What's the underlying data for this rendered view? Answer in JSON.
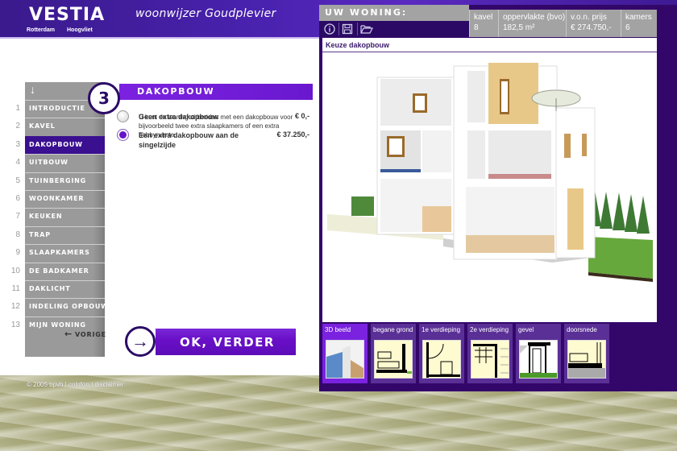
{
  "header": {
    "logo_word": "VESTIA",
    "logo_sub_left": "Rotterdam",
    "logo_sub_right": "Hoogvliet",
    "app_title": "woonwijzer Goudplevier"
  },
  "steps": {
    "head_icon": "down-arrow-icon",
    "head_glyph": "↓",
    "items": [
      {
        "num": "1",
        "label": "INTRODUCTIE",
        "active": false
      },
      {
        "num": "2",
        "label": "KAVEL",
        "active": false
      },
      {
        "num": "3",
        "label": "DAKOPBOUW",
        "active": true
      },
      {
        "num": "4",
        "label": "UITBOUW",
        "active": false
      },
      {
        "num": "5",
        "label": "TUINBERGING",
        "active": false
      },
      {
        "num": "6",
        "label": "WOONKAMER",
        "active": false
      },
      {
        "num": "7",
        "label": "KEUKEN",
        "active": false
      },
      {
        "num": "8",
        "label": "TRAP",
        "active": false
      },
      {
        "num": "9",
        "label": "SLAAPKAMERS",
        "active": false
      },
      {
        "num": "10",
        "label": "DE BADKAMER",
        "active": false
      },
      {
        "num": "11",
        "label": "DAKLICHT",
        "active": false
      },
      {
        "num": "12",
        "label": "INDELING OPBOUW",
        "active": false
      },
      {
        "num": "13",
        "label": "MIJN WONING",
        "active": false
      }
    ]
  },
  "section": {
    "number": "3",
    "title": "DAKOPBOUW",
    "description": "U kunt de woning uitbreiden met een dakopbouw voor bijvoorbeeld twee extra slaapkamers of een extra hobbyruimte.",
    "options": [
      {
        "label": "Geen extra dakopbouw",
        "price": "€ 0,-",
        "selected": false
      },
      {
        "label": "Een extra dakopbouw aan de singelzijde",
        "price": "€ 37.250,-",
        "selected": true
      }
    ]
  },
  "nav": {
    "prev_label": "VORIGE",
    "prev_glyph": "←",
    "next_label": "OK, VERDER",
    "next_glyph": "→"
  },
  "footer": {
    "copyright": "© 2005 bpvh",
    "links": [
      "colofon",
      "disclaimer"
    ],
    "separator": "|"
  },
  "woning": {
    "title": "UW WONING:",
    "tools": [
      {
        "icon": "info-icon",
        "glyph": "ⓘ"
      },
      {
        "icon": "save-icon",
        "glyph": "💾"
      },
      {
        "icon": "open-folder-icon",
        "glyph": "📂"
      }
    ],
    "stats": [
      {
        "label": "kavel",
        "value": "8"
      },
      {
        "label": "oppervlakte (bvo)",
        "value": "182,5 m²"
      },
      {
        "label": "v.o.n. prijs",
        "value": "€ 274.750,-"
      },
      {
        "label": "kamers",
        "value": "6"
      }
    ],
    "viewer_title": "Keuze dakopbouw",
    "views": [
      {
        "label": "3D beeld",
        "active": true
      },
      {
        "label": "begane grond",
        "active": false
      },
      {
        "label": "1e verdieping",
        "active": false
      },
      {
        "label": "2e verdieping",
        "active": false
      },
      {
        "label": "gevel",
        "active": false
      },
      {
        "label": "doorsnede",
        "active": false
      }
    ]
  },
  "colors": {
    "brand_purple": "#6a10c8",
    "dark_purple": "#33076a",
    "nav_gray": "#9a9a9a"
  }
}
